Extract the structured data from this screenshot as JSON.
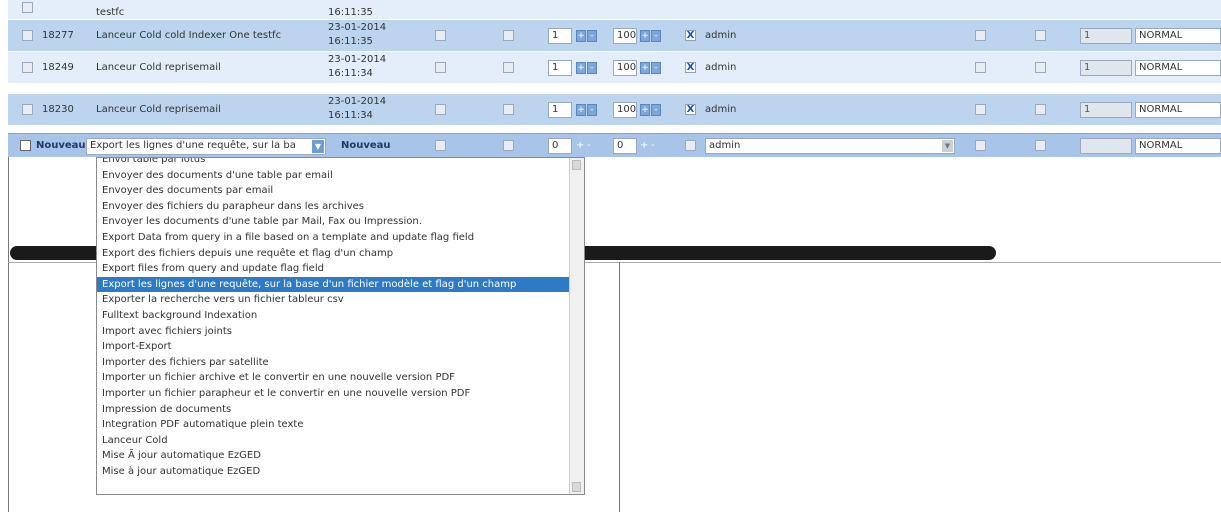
{
  "grid": {
    "rows": [
      {
        "id": "",
        "name": "testfc",
        "date": "",
        "time": "16:11:35",
        "user": "",
        "status": ""
      },
      {
        "id": "18277",
        "name": "Lanceur Cold cold Indexer One testfc",
        "date": "23-01-2014",
        "time": "16:11:35",
        "qty": "1",
        "pct": "100",
        "user": "admin",
        "prio": "1",
        "status": "NORMAL"
      },
      {
        "id": "18249",
        "name": "Lanceur Cold reprisemail",
        "date": "23-01-2014",
        "time": "16:11:34",
        "qty": "1",
        "pct": "100",
        "user": "admin",
        "prio": "1",
        "status": "NORMAL"
      },
      {
        "id": "18230",
        "name": "Lanceur Cold reprisemail",
        "date": "23-01-2014",
        "time": "16:11:34",
        "qty": "1",
        "pct": "100",
        "user": "admin",
        "prio": "1",
        "status": "NORMAL"
      }
    ],
    "new_row": {
      "label": "Nouveau",
      "task_value": "Export les lignes d'une requête, sur la ba",
      "label2": "Nouveau",
      "qty": "0",
      "pct": "0",
      "user": "admin",
      "status": "NORMAL"
    },
    "stepper_plus": "+",
    "stepper_minus": "-",
    "check_mark": "X"
  },
  "dropdown": {
    "items": [
      "Envoi table par lotus",
      "Envoyer des documents d'une table par email",
      "Envoyer des documents par email",
      "Envoyer des fichiers du parapheur dans les archives",
      "Envoyer les documents d'une table par Mail, Fax ou Impression.",
      "Export Data from query in a file based on a template and update flag field",
      "Export des fichiers depuis une requête et flag d'un champ",
      "Export files from query and update flag field",
      "Export les lignes d'une requête, sur la base d'un fichier modèle et flag d'un champ",
      "Exporter la recherche vers un fichier tableur csv",
      "Fulltext background Indexation",
      "Import avec fichiers joints",
      "Import-Export",
      "Importer des fichiers par satellite",
      "Importer un fichier archive et le convertir en une nouvelle version PDF",
      "Importer un fichier parapheur et le convertir en une nouvelle version PDF",
      "Impression de documents",
      "Integration PDF automatique plein texte",
      "Lanceur Cold",
      "Mise Ã  jour automatique EzGED",
      "Mise à jour automatique EzGED"
    ],
    "selected_index": 8
  }
}
